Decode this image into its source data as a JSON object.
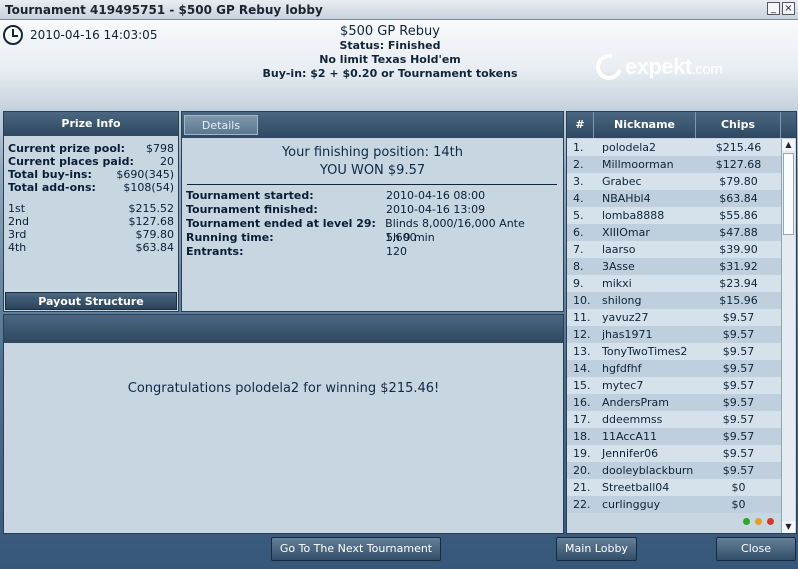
{
  "window": {
    "title": "Tournament 419495751 - $500 GP Rebuy lobby",
    "minimize_glyph": "_",
    "close_glyph": "×"
  },
  "header": {
    "datetime": "2010-04-16 14:03:05",
    "name": "$500 GP Rebuy",
    "status": "Status: Finished",
    "game": "No limit Texas Hold'em",
    "buyin": "Buy-in: $2 + $0.20 or Tournament tokens",
    "logo_text": "expekt",
    "logo_suffix": ".com"
  },
  "prize_info": {
    "title": "Prize Info",
    "stats": [
      {
        "label": "Current prize pool:",
        "value": "$798"
      },
      {
        "label": "Current places paid:",
        "value": "20"
      },
      {
        "label": "Total buy-ins:",
        "value": "$690(345)"
      },
      {
        "label": "Total add-ons:",
        "value": "$108(54)"
      }
    ],
    "places": [
      {
        "label": "1st",
        "value": "$215.52"
      },
      {
        "label": "2nd",
        "value": "$127.68"
      },
      {
        "label": "3rd",
        "value": "$79.80"
      },
      {
        "label": "4th",
        "value": "$63.84"
      }
    ],
    "payout_button": "Payout Structure"
  },
  "details": {
    "tab": "Details",
    "finishing": "Your finishing position:  14th",
    "won": "YOU WON $9.57",
    "rows": [
      {
        "label": "Tournament started:",
        "value": "2010-04-16 08:00"
      },
      {
        "label": "Tournament finished:",
        "value": "2010-04-16 13:09"
      },
      {
        "label": "Tournament ended at level 29:",
        "value": "Blinds 8,000/16,000 Ante 1,600"
      },
      {
        "label": "Running time:",
        "value": "5h 9 min"
      },
      {
        "label": "Entrants:",
        "value": "120"
      }
    ]
  },
  "congrats": {
    "message": "Congratulations polodela2 for winning $215.46!"
  },
  "players": {
    "headers": {
      "num": "#",
      "name": "Nickname",
      "chips": "Chips"
    },
    "rows": [
      {
        "n": "1.",
        "name": "polodela2",
        "chips": "$215.46"
      },
      {
        "n": "2.",
        "name": "Millmoorman",
        "chips": "$127.68"
      },
      {
        "n": "3.",
        "name": "Grabec",
        "chips": "$79.80"
      },
      {
        "n": "4.",
        "name": "NBAHbl4",
        "chips": "$63.84"
      },
      {
        "n": "5.",
        "name": "lomba8888",
        "chips": "$55.86"
      },
      {
        "n": "6.",
        "name": "XIIIOmar",
        "chips": "$47.88"
      },
      {
        "n": "7.",
        "name": "laarso",
        "chips": "$39.90"
      },
      {
        "n": "8.",
        "name": "3Asse",
        "chips": "$31.92"
      },
      {
        "n": "9.",
        "name": "mikxi",
        "chips": "$23.94"
      },
      {
        "n": "10.",
        "name": "shilong",
        "chips": "$15.96"
      },
      {
        "n": "11.",
        "name": "yavuz27",
        "chips": "$9.57"
      },
      {
        "n": "12.",
        "name": "jhas1971",
        "chips": "$9.57"
      },
      {
        "n": "13.",
        "name": "TonyTwoTimes2",
        "chips": "$9.57"
      },
      {
        "n": "14.",
        "name": "hgfdfhf",
        "chips": "$9.57"
      },
      {
        "n": "15.",
        "name": "mytec7",
        "chips": "$9.57"
      },
      {
        "n": "16.",
        "name": "AndersPram",
        "chips": "$9.57"
      },
      {
        "n": "17.",
        "name": "ddeemmss",
        "chips": "$9.57"
      },
      {
        "n": "18.",
        "name": "11AccA11",
        "chips": "$9.57"
      },
      {
        "n": "19.",
        "name": "Jennifer06",
        "chips": "$9.57"
      },
      {
        "n": "20.",
        "name": "dooleyblackburn",
        "chips": "$9.57"
      },
      {
        "n": "21.",
        "name": "Streetball04",
        "chips": "$0"
      },
      {
        "n": "22.",
        "name": "curlingguy",
        "chips": "$0"
      }
    ],
    "status_dots": [
      "#2fa52a",
      "#e0a321",
      "#d43a22"
    ],
    "scroll_up_glyph": "▲",
    "scroll_down_glyph": "▼"
  },
  "buttons": {
    "next": "Go To The Next Tournament",
    "lobby": "Main Lobby",
    "close": "Close"
  }
}
